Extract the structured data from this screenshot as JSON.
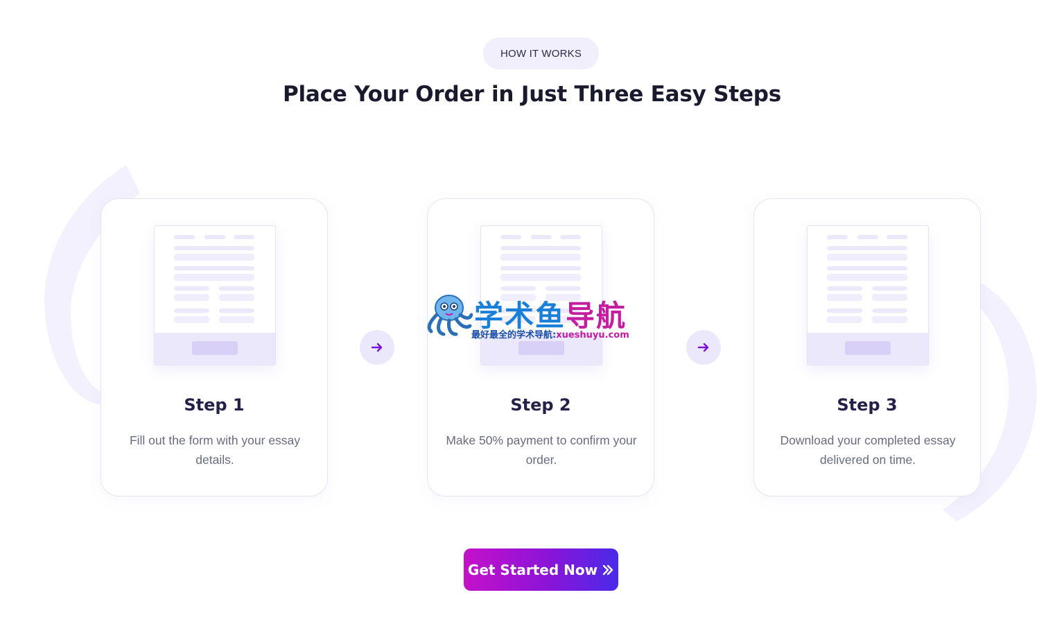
{
  "section": {
    "badge": "HOW IT WORKS",
    "title": "Place Your Order in Just Three Easy Steps"
  },
  "steps": [
    {
      "title": "Step 1",
      "description": "Fill out the form with your essay details."
    },
    {
      "title": "Step 2",
      "description": "Make 50% payment to confirm your order."
    },
    {
      "title": "Step 3",
      "description": "Download your completed essay delivered on time."
    }
  ],
  "icons": {
    "step_connector": "arrow-right-icon",
    "cta": "double-chevron-right-icon",
    "illustration": "form-document-icon"
  },
  "cta": {
    "label": "Get Started Now",
    "arrow": "»"
  },
  "watermark": {
    "title_part1": "学术鱼",
    "title_part2": "导航",
    "subtitle_part1": "最好最全的学术导航:",
    "subtitle_part2": "xueshuyu.com"
  },
  "colors": {
    "accent_purple": "#8a14d8",
    "accent_magenta": "#c511c9",
    "accent_blue": "#4a2ae8",
    "soft_lavender": "#ece8fc"
  }
}
